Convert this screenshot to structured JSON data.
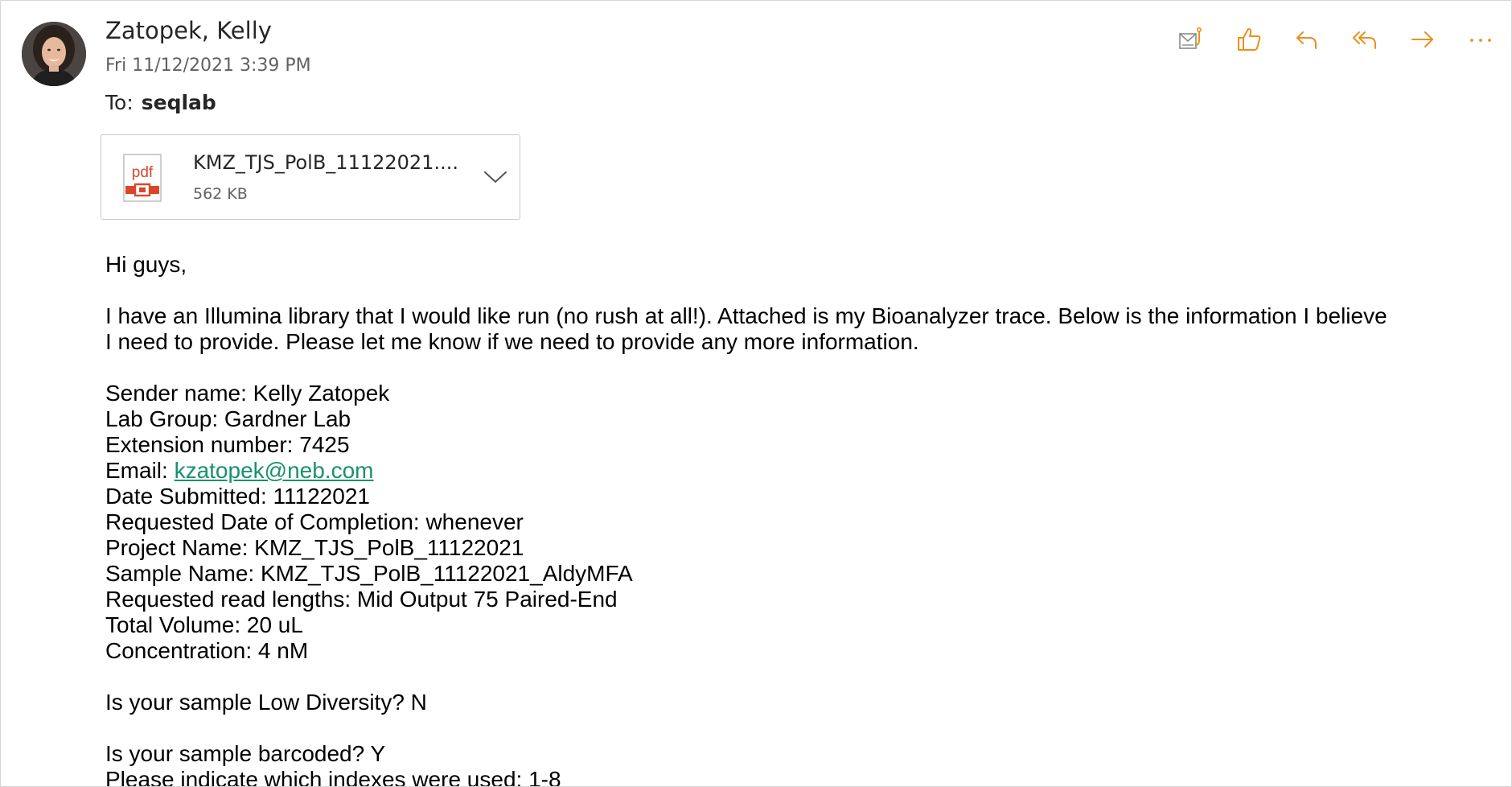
{
  "header": {
    "sender_name": "Zatopek, Kelly",
    "sent_date": "Fri 11/12/2021 3:39 PM",
    "to_label": "To:",
    "to_recipient": "seqlab"
  },
  "toolbar": {
    "accent_color": "#e8911e",
    "icons": [
      "tracking-icon",
      "like-icon",
      "reply-icon",
      "reply-all-icon",
      "forward-icon",
      "more-icon"
    ]
  },
  "attachment": {
    "icon": "pdf-icon",
    "icon_text": "pdf",
    "filename": "KMZ_TJS_PolB_11122021....",
    "size": "562 KB"
  },
  "body": {
    "greeting": "Hi guys,",
    "intro_line1": "I have an Illumina library that I would like run (no rush at all!).  Attached is my Bioanalyzer trace.  Below is the information I believe",
    "intro_line2": "I need to provide. Please let me know if we need to provide any more information.",
    "sender_line": "Sender name: Kelly Zatopek",
    "lab_group_line": "Lab Group: Gardner Lab",
    "extension_line": "Extension number: 7425",
    "email_label": "Email: ",
    "email_link": "kzatopek@neb.com",
    "date_submitted_line": "Date Submitted: 11122021",
    "completion_line": "Requested Date of Completion: whenever",
    "project_line": "Project Name: KMZ_TJS_PolB_11122021",
    "sample_line": "Sample Name: KMZ_TJS_PolB_11122021_AldyMFA",
    "read_lengths_line": "Requested read lengths: Mid Output 75 Paired-End",
    "volume_line": "Total Volume: 20 uL",
    "concentration_line": "Concentration: 4 nM",
    "low_diversity_line": "Is your sample Low Diversity? N",
    "barcoded_line": "Is your sample barcoded? Y",
    "indexes_line": "Please indicate which indexes were used: 1-8"
  },
  "colors": {
    "link": "#1a9070",
    "pdf_red": "#d9472b"
  }
}
